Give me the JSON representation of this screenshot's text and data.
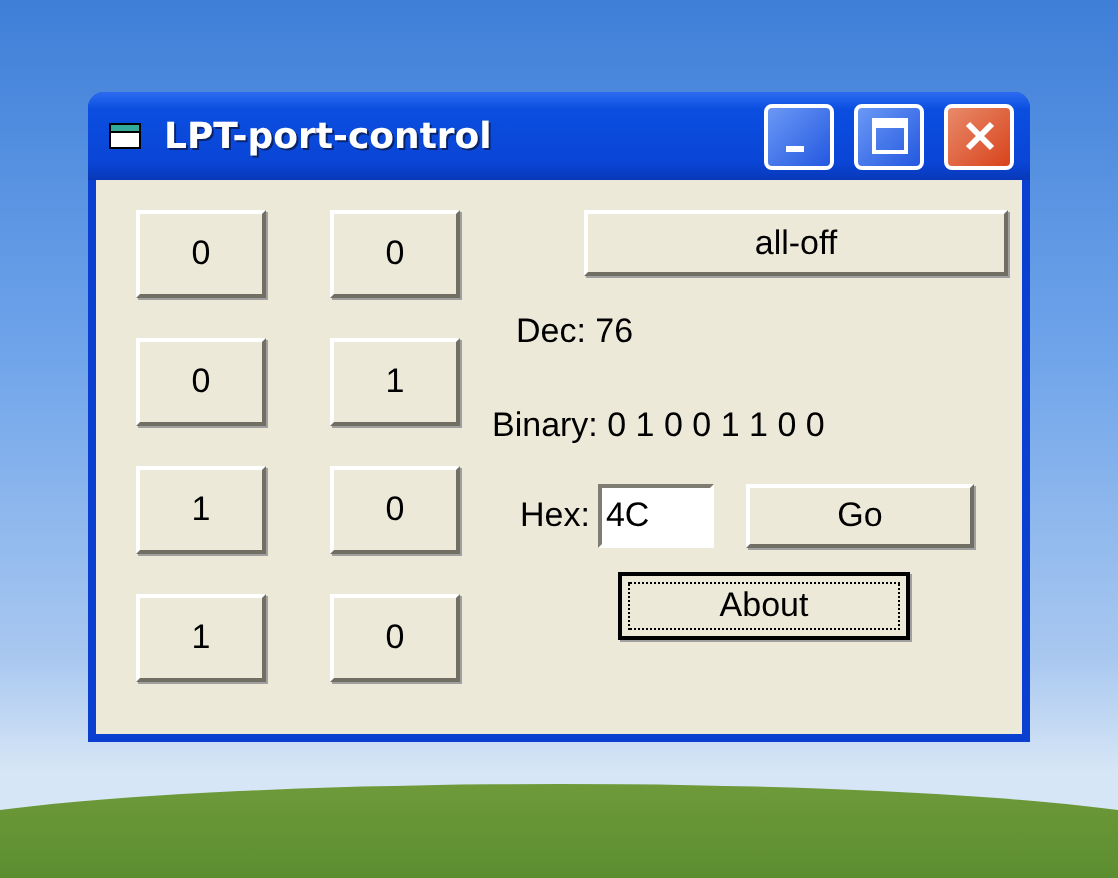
{
  "window": {
    "title": "LPT-port-control"
  },
  "bit_buttons": [
    "0",
    "0",
    "0",
    "1",
    "1",
    "0",
    "1",
    "0"
  ],
  "all_off_button": "all-off",
  "dec": "Dec: 76",
  "binary": "Binary: 0 1 0 0 1 1 0 0",
  "hex": {
    "label": "Hex:",
    "value": "4C"
  },
  "go_button": "Go",
  "about_button": {
    "label": "About",
    "focused": true
  }
}
